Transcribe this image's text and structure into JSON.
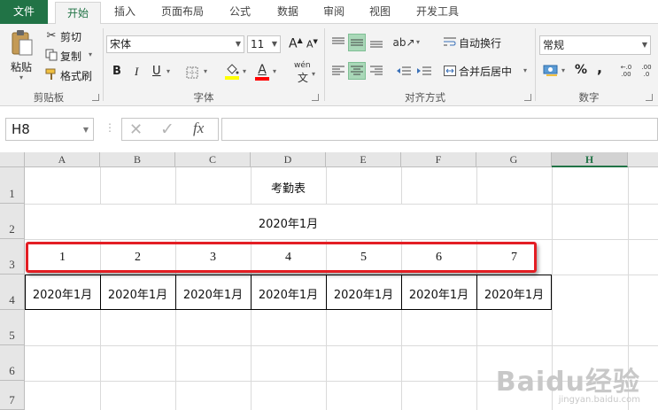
{
  "tabs": [
    {
      "label": "文件"
    },
    {
      "label": "开始"
    },
    {
      "label": "插入"
    },
    {
      "label": "页面布局"
    },
    {
      "label": "公式"
    },
    {
      "label": "数据"
    },
    {
      "label": "审阅"
    },
    {
      "label": "视图"
    },
    {
      "label": "开发工具"
    }
  ],
  "ribbon": {
    "clipboard": {
      "paste_label": "粘贴",
      "cut_label": "剪切",
      "copy_label": "复制",
      "format_painter_label": "格式刷",
      "group_label": "剪贴板"
    },
    "font": {
      "font_name": "宋体",
      "font_size": "11",
      "bold": "B",
      "italic": "I",
      "underline": "U",
      "grow": "A",
      "shrink": "A",
      "font_color_letter": "A",
      "phonetic": "wén",
      "group_label": "字体",
      "fill_color": "#ffff00",
      "font_color": "#ff0000"
    },
    "alignment": {
      "wrap_label": "自动换行",
      "merge_label": "合并后居中",
      "group_label": "对齐方式"
    },
    "number": {
      "format": "常规",
      "percent": "%",
      "comma": ",",
      "inc_decimal": ".00",
      "dec_decimal": ".0",
      "group_label": "数字"
    }
  },
  "formula_bar": {
    "name_box": "H8",
    "cancel_icon": "✕",
    "enter_icon": "✓",
    "fx_label": "fx",
    "formula": ""
  },
  "sheet": {
    "columns": [
      "A",
      "B",
      "C",
      "D",
      "E",
      "F",
      "G",
      "H"
    ],
    "selected_column": "H",
    "rows": [
      "1",
      "2",
      "3",
      "4",
      "5",
      "6",
      "7"
    ],
    "title": "考勤表",
    "month": "2020年1月",
    "days": [
      "1",
      "2",
      "3",
      "4",
      "5",
      "6",
      "7"
    ],
    "row4": [
      "2020年1月",
      "2020年1月",
      "2020年1月",
      "2020年1月",
      "2020年1月",
      "2020年1月",
      "2020年1月"
    ]
  },
  "watermark": {
    "text": "Baidu经验",
    "url": "jingyan.baidu.com"
  }
}
